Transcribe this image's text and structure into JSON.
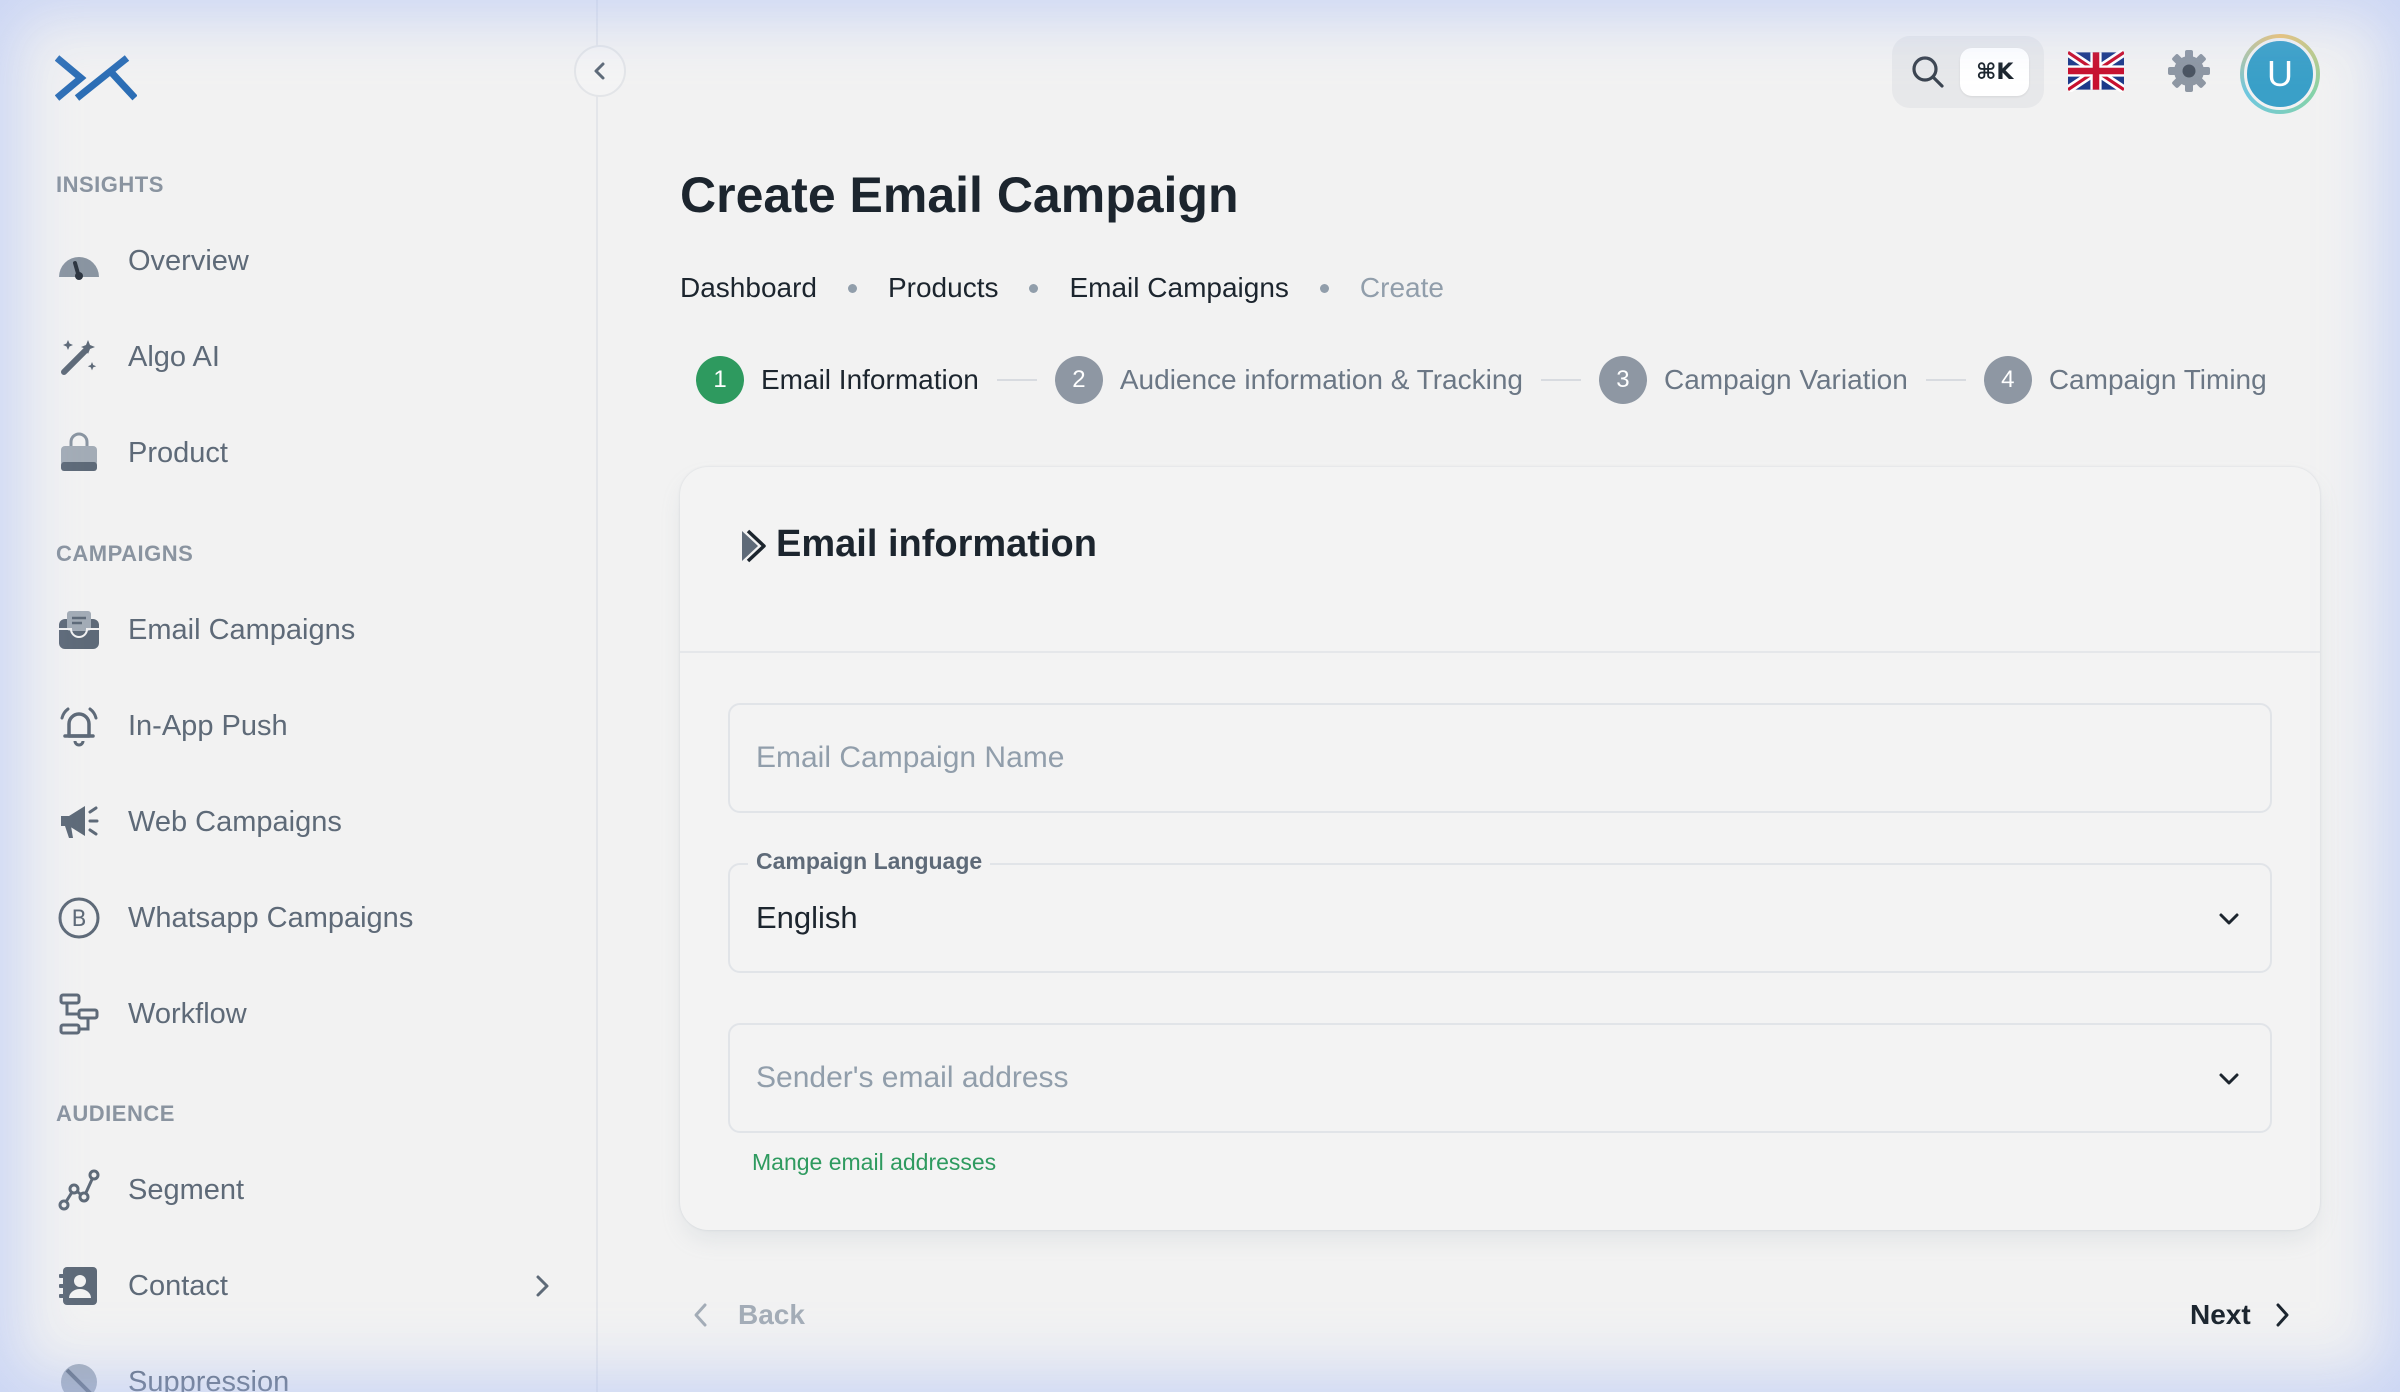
{
  "sidebar": {
    "sections": [
      {
        "title": "INSIGHTS"
      },
      {
        "title": "CAMPAIGNS"
      },
      {
        "title": "AUDIENCE"
      }
    ],
    "items": [
      {
        "label": "Overview",
        "icon": "speedometer-icon"
      },
      {
        "label": "Algo AI",
        "icon": "magic-wand-icon"
      },
      {
        "label": "Product",
        "icon": "shopping-bag-icon"
      },
      {
        "label": "Email Campaigns",
        "icon": "inbox-icon"
      },
      {
        "label": "In-App Push",
        "icon": "bell-ringing-icon"
      },
      {
        "label": "Web Campaigns",
        "icon": "megaphone-icon"
      },
      {
        "label": "Whatsapp Campaigns",
        "icon": "whatsapp-b-icon"
      },
      {
        "label": "Workflow",
        "icon": "workflow-icon"
      },
      {
        "label": "Segment",
        "icon": "segment-graph-icon"
      },
      {
        "label": "Contact",
        "icon": "contact-card-icon"
      },
      {
        "label": "Suppression",
        "icon": "block-icon"
      }
    ]
  },
  "topbar": {
    "search_shortcut": "⌘K",
    "language_flag": "uk-flag-icon",
    "avatar_initial": "U",
    "avatar_color": "#3aa0c8"
  },
  "page": {
    "title": "Create Email Campaign",
    "breadcrumb": [
      "Dashboard",
      "Products",
      "Email Campaigns",
      "Create"
    ]
  },
  "stepper": {
    "steps": [
      {
        "num": "1",
        "label": "Email Information"
      },
      {
        "num": "2",
        "label": "Audience information & Tracking"
      },
      {
        "num": "3",
        "label": "Campaign Variation"
      },
      {
        "num": "4",
        "label": "Campaign Timing"
      }
    ],
    "active_color": "#2e9a5f"
  },
  "form": {
    "title": "Email information",
    "campaign_name_placeholder": "Email Campaign Name",
    "language_label": "Campaign Language",
    "language_value": "English",
    "sender_placeholder": "Sender's email address",
    "manage_link": "Mange email addresses"
  },
  "nav": {
    "back_label": "Back",
    "next_label": "Next"
  }
}
